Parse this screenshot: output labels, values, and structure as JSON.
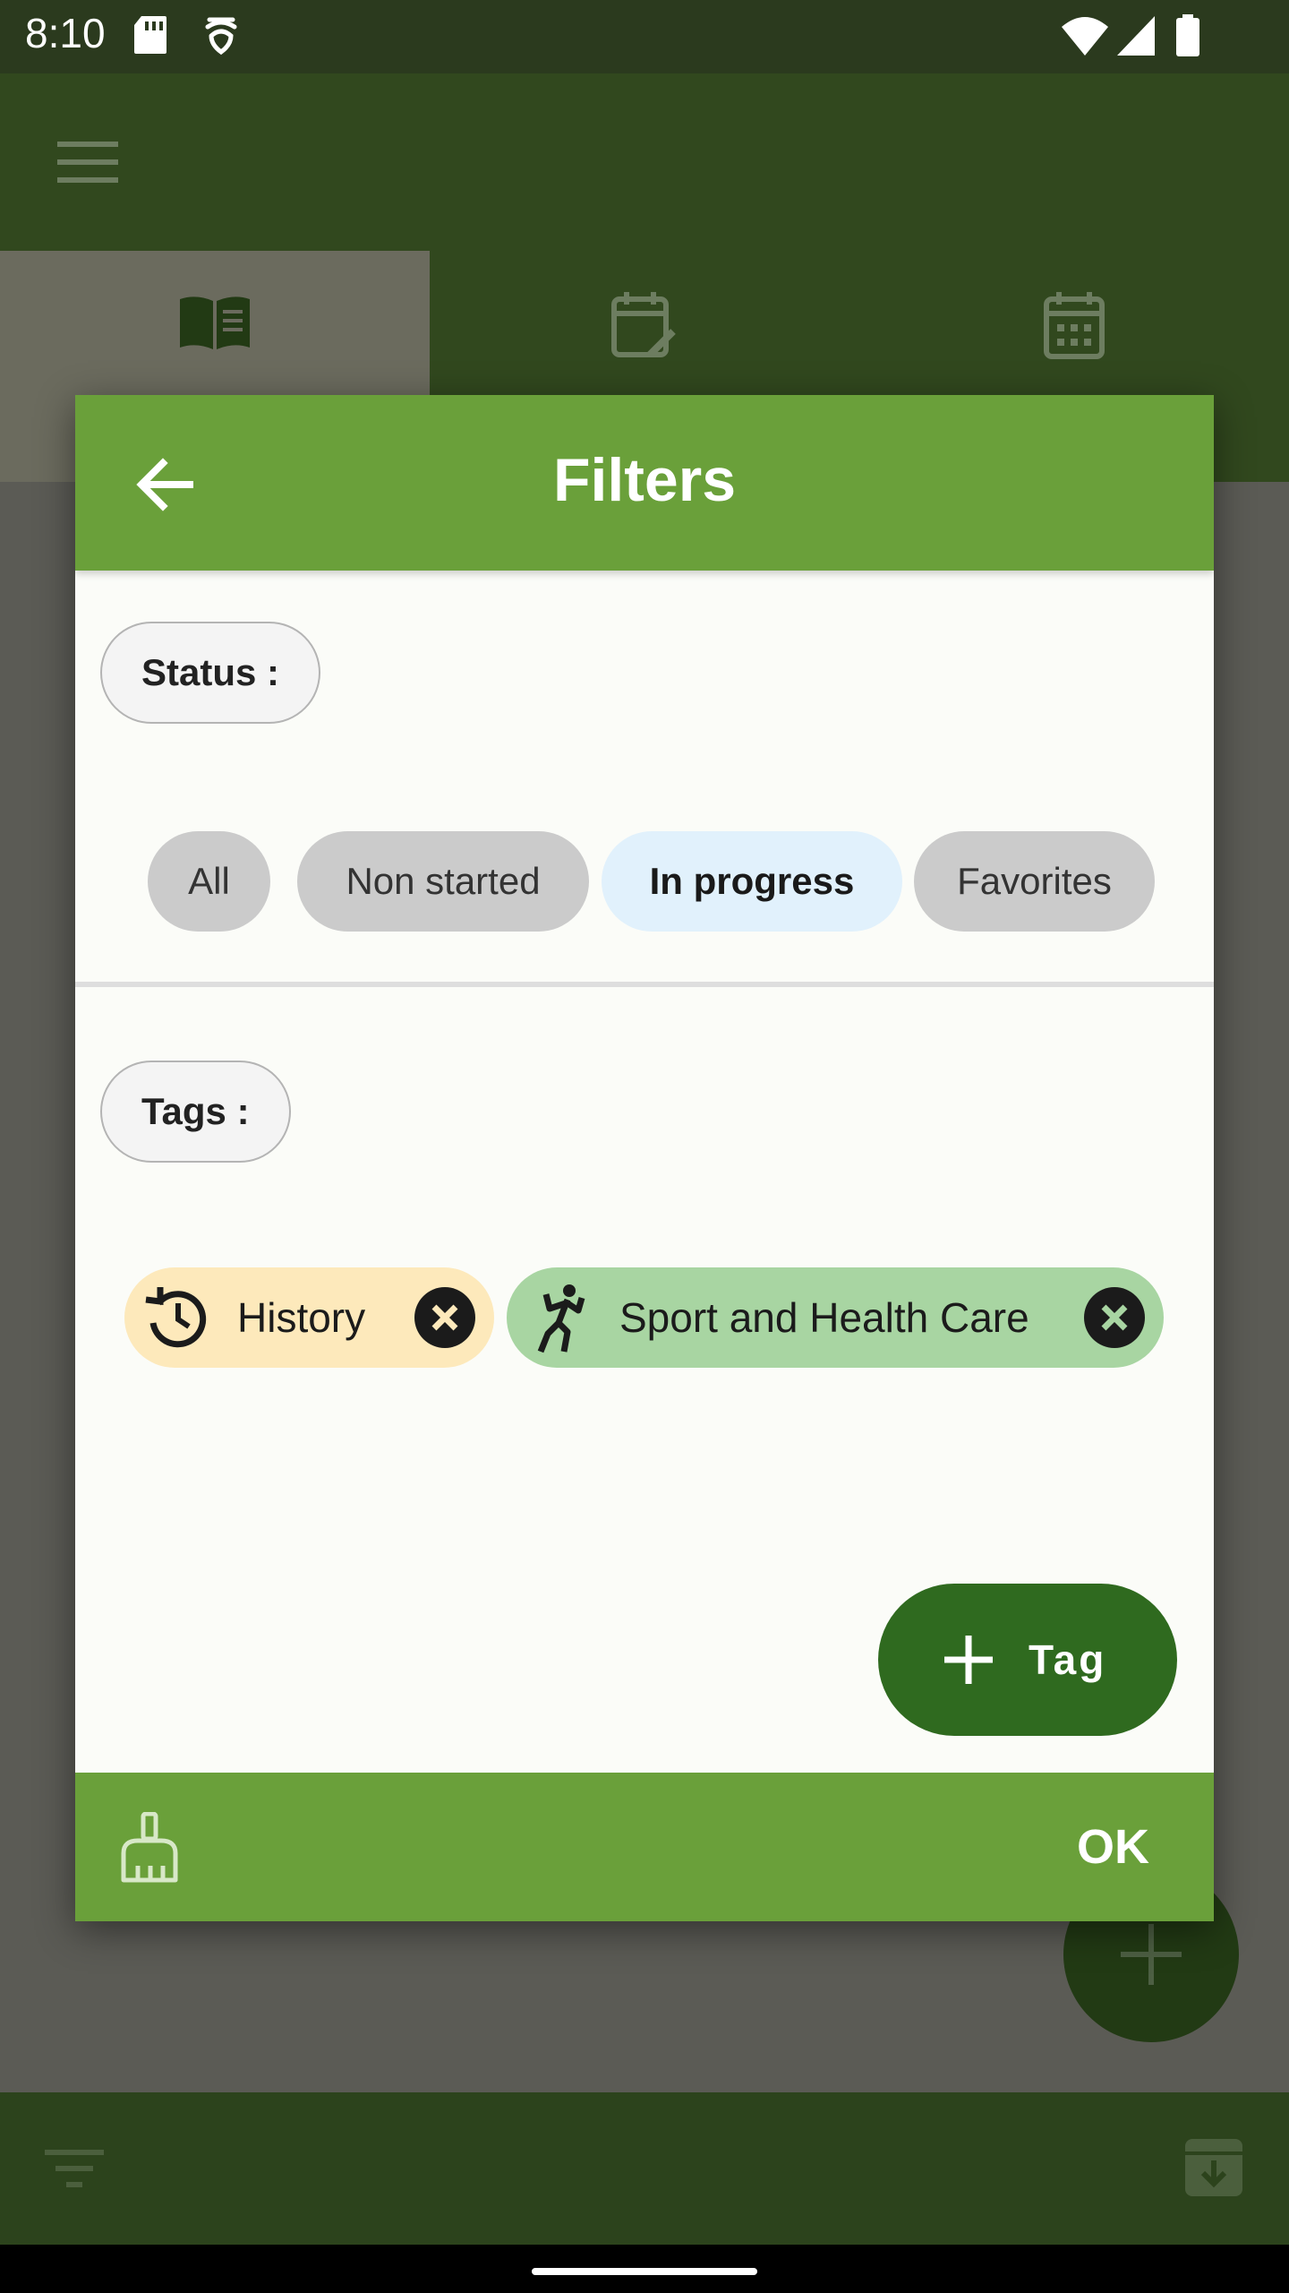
{
  "status_bar": {
    "time": "8:10"
  },
  "dialog": {
    "title": "Filters",
    "status_section": {
      "label": "Status :",
      "chips": [
        "All",
        "Non started",
        "In progress",
        "Favorites"
      ],
      "selected": "In progress"
    },
    "tags_section": {
      "label": "Tags :",
      "tags": [
        {
          "label": "History",
          "icon": "history-icon",
          "color": "#fde9bb"
        },
        {
          "label": "Sport and Health Care",
          "icon": "sport-icon",
          "color": "#a8d5a2"
        }
      ]
    },
    "add_tag_label": "Tag",
    "ok_label": "OK"
  },
  "colors": {
    "accent": "#6aa03a",
    "primary_dark": "#2f6a1f",
    "chip_selected": "#e1f1fc",
    "chip_default": "#cbcbcb"
  }
}
